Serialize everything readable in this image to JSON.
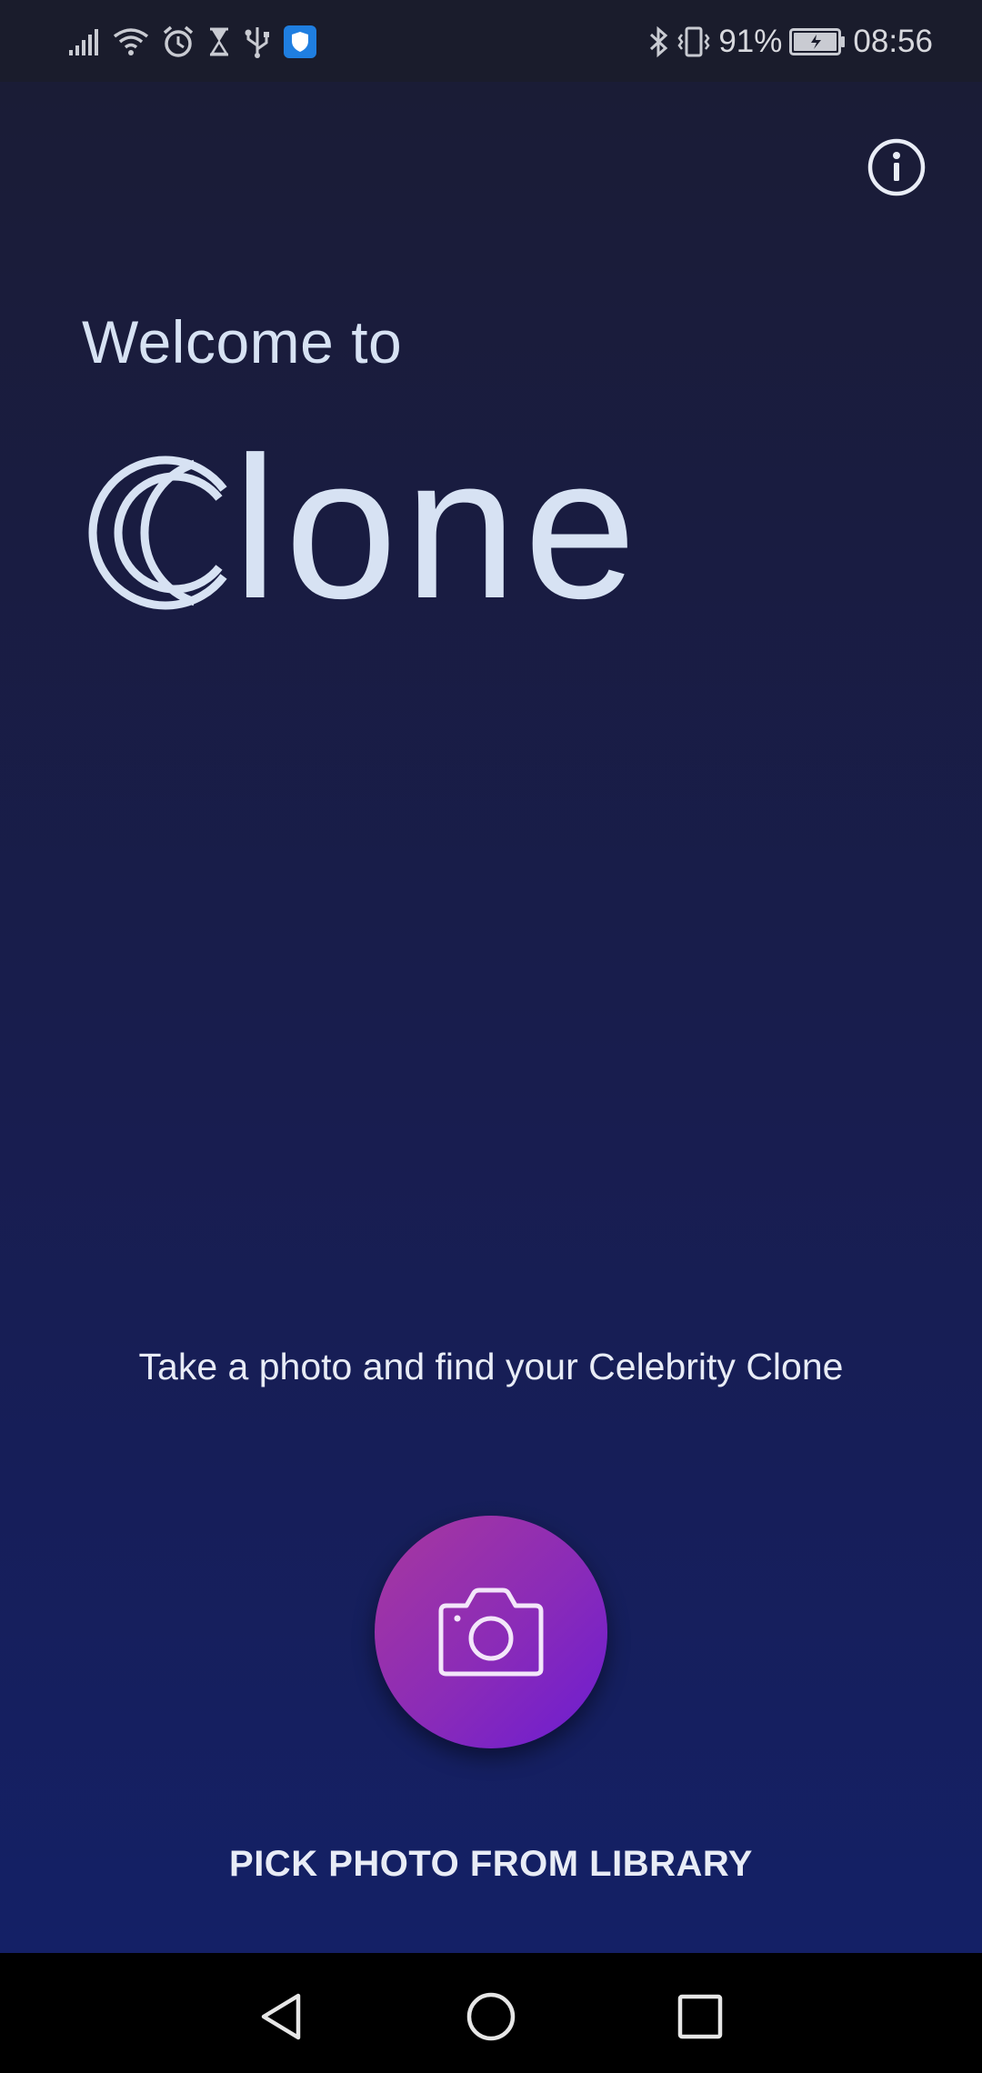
{
  "status_bar": {
    "battery_percent": "91%",
    "time": "08:56",
    "icons_left": [
      "signal-icon",
      "wifi-icon",
      "alarm-icon",
      "hourglass-icon",
      "usb-icon",
      "shield-app-icon"
    ],
    "icons_right": [
      "bluetooth-icon",
      "vibrate-icon",
      "battery-icon"
    ]
  },
  "main": {
    "info_icon": "info-icon",
    "welcome_text": "Welcome to",
    "logo_text": "lone",
    "logo_full": "Clone",
    "tagline": "Take a photo and find your Celebrity Clone",
    "camera_icon": "camera-icon",
    "library_button_label": "PICK PHOTO FROM LIBRARY"
  },
  "nav_bar": {
    "icons": [
      "back-icon",
      "home-icon",
      "recents-icon"
    ]
  },
  "colors": {
    "status_bg": "#1a1c2c",
    "app_bg_top": "#1a1c36",
    "app_bg_bottom": "#142066",
    "text_primary": "#d7e2f3",
    "camera_gradient_start": "#a8389e",
    "camera_gradient_end": "#6c1cd2",
    "shield_badge": "#1f7ee0"
  }
}
